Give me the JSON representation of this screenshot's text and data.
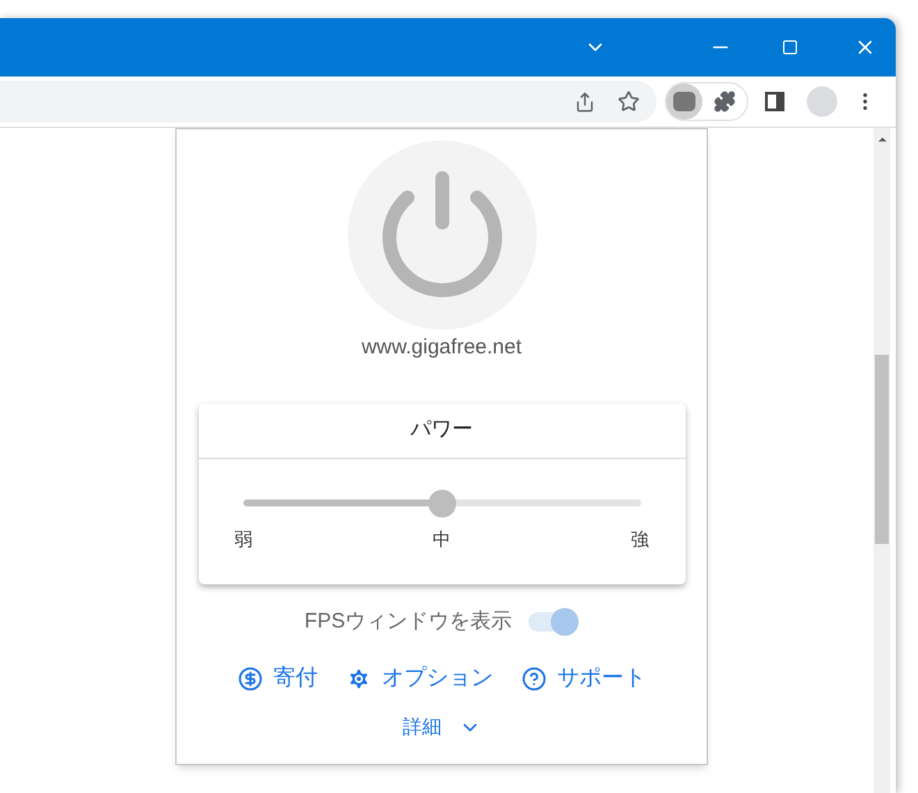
{
  "popup": {
    "site": "www.gigafree.net",
    "power_card": {
      "title": "パワー",
      "slider": {
        "level": 0.5
      },
      "labels": [
        "弱",
        "中",
        "強"
      ]
    },
    "fps_toggle": {
      "label": "FPSウィンドウを表示",
      "on": true
    },
    "links": [
      {
        "kind": "donate",
        "label": "寄付"
      },
      {
        "kind": "options",
        "label": "オプション"
      },
      {
        "kind": "support",
        "label": "サポート"
      }
    ],
    "details": {
      "label": "詳細",
      "expanded": false
    }
  }
}
